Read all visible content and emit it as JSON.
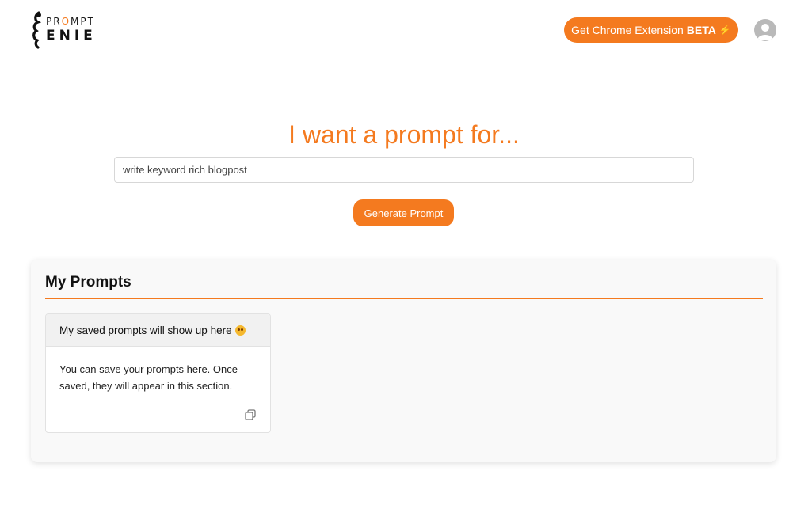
{
  "header": {
    "logo": {
      "top_text": "PR",
      "top_accent": "O",
      "top_text_end": "MPT",
      "bottom_text": "ENIE",
      "alt": "Prompt Genie"
    },
    "extension_button": {
      "label": "Get Chrome Extension",
      "badge": "BETA",
      "icon": "lightning-icon"
    },
    "avatar": {
      "icon": "user-avatar-icon"
    }
  },
  "hero": {
    "title": "I want a prompt for...",
    "input_value": "write keyword rich blogpost",
    "generate_label": "Generate Prompt"
  },
  "my_prompts": {
    "title": "My Prompts",
    "card": {
      "header": "My saved prompts will show up here",
      "header_emoji": "starstruck-emoji",
      "body": "You can save your prompts here. Once saved, they will appear in this section.",
      "action_icon": "copy-icon"
    }
  },
  "colors": {
    "accent": "#f47a1f",
    "panel_bg": "#f9f9f9",
    "avatar": "#b9b9b9"
  }
}
